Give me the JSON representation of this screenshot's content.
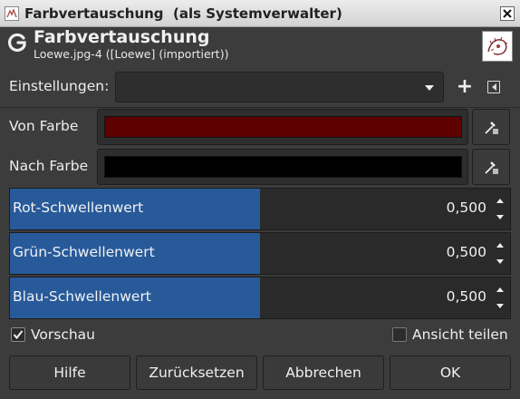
{
  "window": {
    "title": "Farbvertauschung  (als Systemverwalter)"
  },
  "header": {
    "title": "Farbvertauschung",
    "subtitle": "Loewe.jpg-4 ([Loewe] (importiert))"
  },
  "settings": {
    "label": "Einstellungen:",
    "value": ""
  },
  "from_color": {
    "label": "Von Farbe",
    "color": "#5e0000"
  },
  "to_color": {
    "label": "Nach Farbe",
    "color": "#000000"
  },
  "thresholds": [
    {
      "label": "Rot-Schwellenwert",
      "value": "0,500",
      "fraction": 0.5
    },
    {
      "label": "Grün-Schwellenwert",
      "value": "0,500",
      "fraction": 0.5
    },
    {
      "label": "Blau-Schwellenwert",
      "value": "0,500",
      "fraction": 0.5
    }
  ],
  "preview": {
    "label": "Vorschau",
    "checked": true
  },
  "split_view": {
    "label": "Ansicht teilen",
    "checked": false
  },
  "buttons": {
    "help": "Hilfe",
    "reset": "Zurücksetzen",
    "cancel": "Abbrechen",
    "ok": "OK"
  },
  "colors": {
    "background": "#3c3c3c",
    "slider_fill": "#285a9a"
  }
}
